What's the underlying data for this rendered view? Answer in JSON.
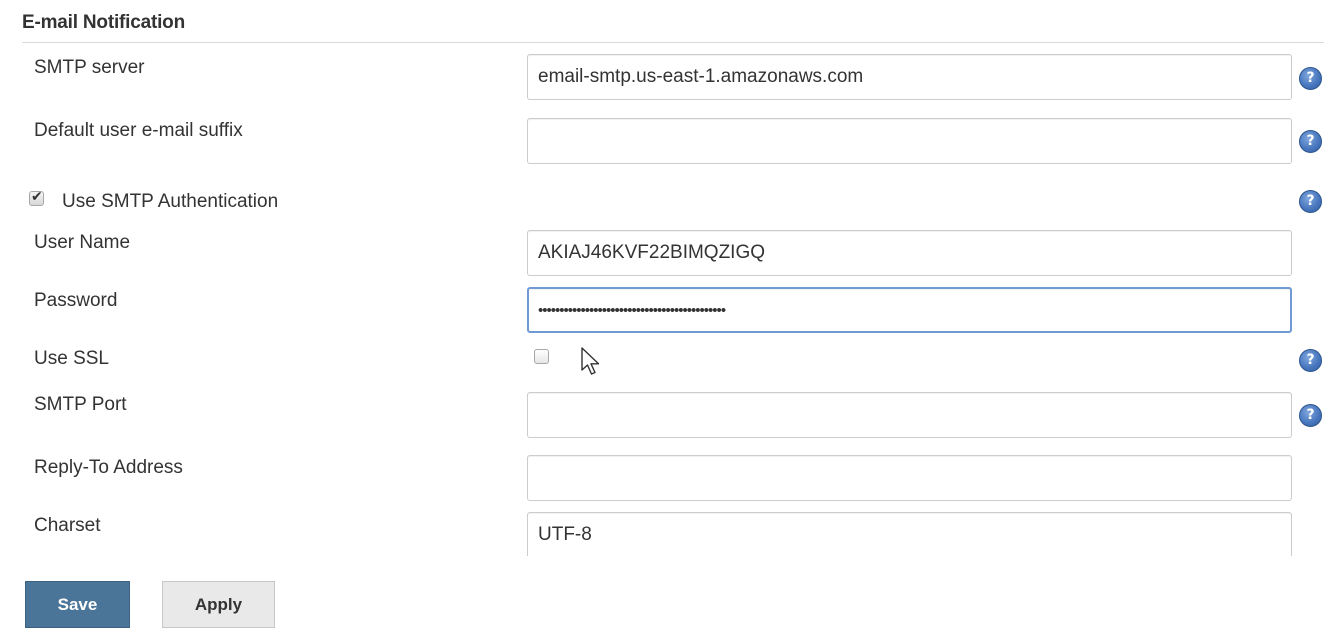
{
  "section": {
    "title": "E-mail Notification"
  },
  "fields": {
    "smtp_server": {
      "label": "SMTP server",
      "value": "email-smtp.us-east-1.amazonaws.com"
    },
    "email_suffix": {
      "label": "Default user e-mail suffix",
      "value": ""
    },
    "use_smtp_auth": {
      "label": "Use SMTP Authentication",
      "checked": true
    },
    "user_name": {
      "label": "User Name",
      "value": "AKIAJ46KVF22BIMQZIGQ"
    },
    "password": {
      "label": "Password",
      "value": "••••••••••••••••••••••••••••••••••••••••••••"
    },
    "use_ssl": {
      "label": "Use SSL",
      "checked": false
    },
    "smtp_port": {
      "label": "SMTP Port",
      "value": ""
    },
    "reply_to": {
      "label": "Reply-To Address",
      "value": ""
    },
    "charset": {
      "label": "Charset",
      "value": "UTF-8"
    }
  },
  "help_icon": {
    "glyph": "?",
    "icon": "question-help-icon",
    "color": "#4a78bf"
  },
  "buttons": {
    "save": "Save",
    "apply": "Apply"
  },
  "colors": {
    "save_button": "#4b7598",
    "apply_button": "#e9e9e9",
    "focus_border": "#6f9ad3"
  }
}
